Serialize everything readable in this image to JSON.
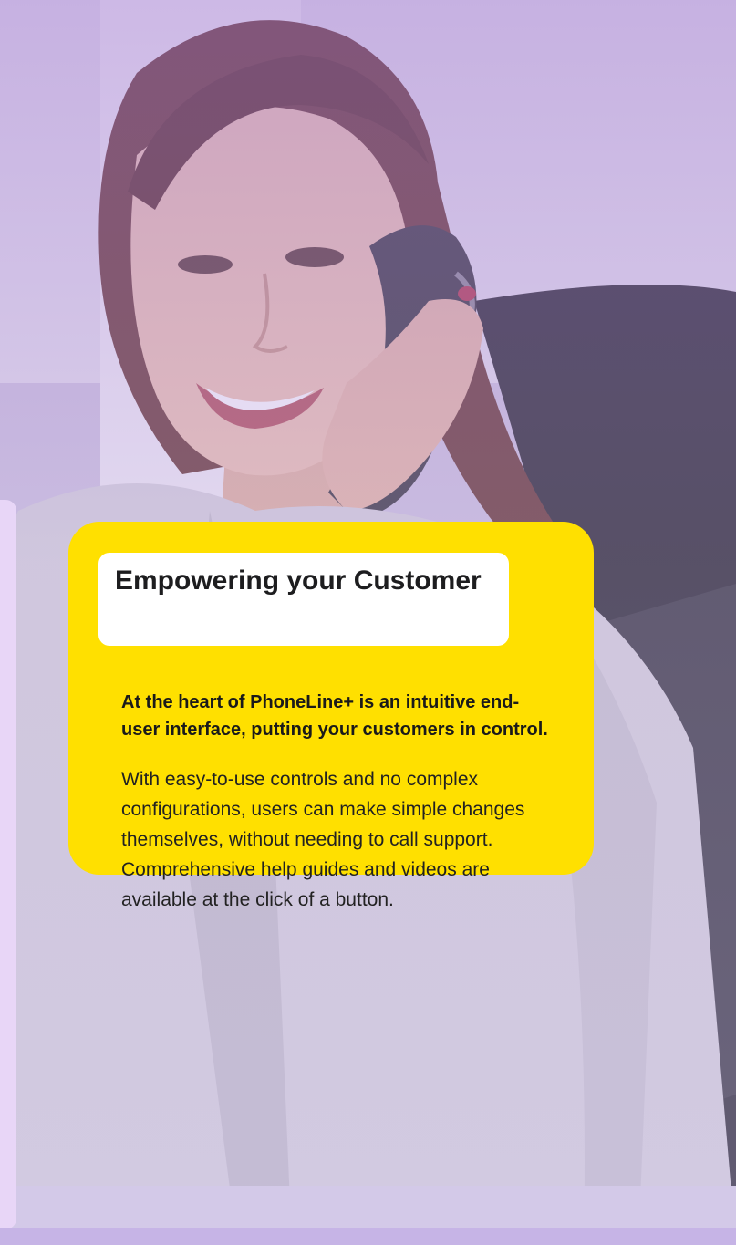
{
  "card": {
    "title": "Empowering your Customer",
    "lead": "At the heart of PhoneLine+ is an intuitive end-user interface, putting your customers in control.",
    "body": "With easy-to-use controls and no complex configurations, users can make simple changes themselves, without needing to call support. Comprehensive help guides and videos are available at the click of a button."
  },
  "colors": {
    "card_background": "#ffe000",
    "title_box_background": "#ffffff",
    "overlay_tint": "#a078d2",
    "side_panel": "#e8d6f7"
  }
}
